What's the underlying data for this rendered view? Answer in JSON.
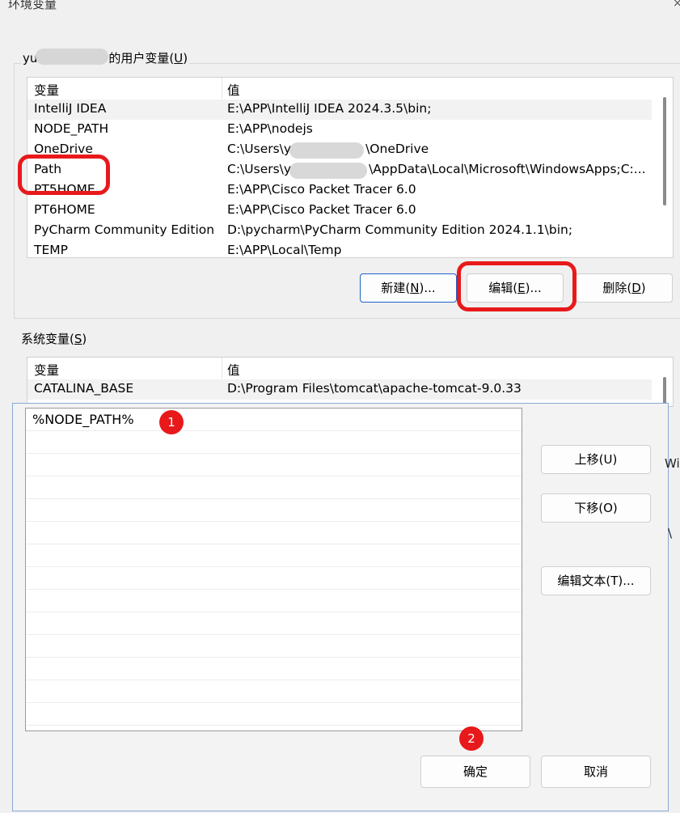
{
  "env_dialog": {
    "title": "环境变量",
    "close_glyph": "×",
    "user_group_label_prefix": "yu",
    "user_group_label_suffix": "的用户变量(",
    "user_group_label_key": "U",
    "user_group_label_end": ")",
    "columns": [
      "变量",
      "值"
    ],
    "user_vars": [
      {
        "name": "IntelliJ IDEA",
        "value": "E:\\APP\\IntelliJ IDEA 2024.3.5\\bin;"
      },
      {
        "name": "NODE_PATH",
        "value": "E:\\APP\\nodejs"
      },
      {
        "name": "OneDrive",
        "value_prefix": "C:\\Users\\y",
        "value_suffix": "\\OneDrive"
      },
      {
        "name": "Path",
        "value_prefix": "C:\\Users\\y",
        "value_suffix": "\\AppData\\Local\\Microsoft\\WindowsApps;C:..."
      },
      {
        "name": "PT5HOME",
        "value": "E:\\APP\\Cisco Packet Tracer 6.0"
      },
      {
        "name": "PT6HOME",
        "value": "E:\\APP\\Cisco Packet Tracer 6.0"
      },
      {
        "name": "PyCharm Community Edition",
        "value": "D:\\pycharm\\PyCharm Community Edition 2024.1.1\\bin;"
      },
      {
        "name": "TEMP",
        "value": "E:\\APP\\Local\\Temp"
      }
    ],
    "buttons": {
      "new_label": "新建(",
      "new_key": "N",
      "new_end": ")...",
      "edit_label": "编辑(",
      "edit_key": "E",
      "edit_end": ")...",
      "delete_label": "删除(",
      "delete_key": "D",
      "delete_end": ")"
    },
    "system_group_label": "系统变量(",
    "system_group_key": "S",
    "system_group_end": ")",
    "system_vars": [
      {
        "name": "CATALINA_BASE",
        "value": "D:\\Program Files\\tomcat\\apache-tomcat-9.0.33"
      }
    ]
  },
  "edit_dialog": {
    "path_entries": [
      "%NODE_PATH%"
    ],
    "buttons": {
      "move_up": "上移(U)",
      "move_down": "下移(O)",
      "edit_text": "编辑文本(T)...",
      "ok": "确定",
      "cancel": "取消"
    }
  },
  "annotations": {
    "badge_1": "1",
    "badge_2": "2",
    "ring_color": "#e8191b"
  },
  "side_fragments": [
    "Wi",
    "\\"
  ]
}
